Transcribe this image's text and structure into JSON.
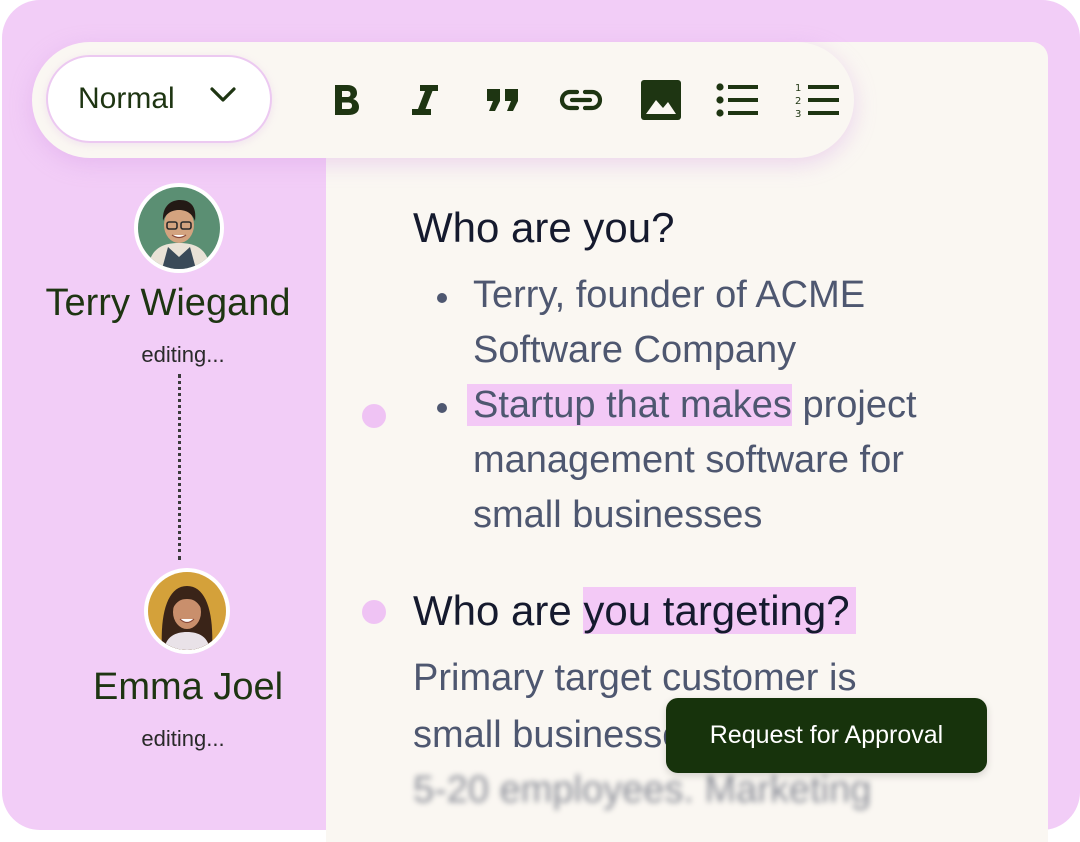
{
  "toolbar": {
    "style_select": {
      "value": "Normal",
      "icon": "chevron-down-icon"
    },
    "buttons": [
      {
        "name": "bold",
        "icon": "bold-icon"
      },
      {
        "name": "italic",
        "icon": "italic-icon"
      },
      {
        "name": "quote",
        "icon": "quote-icon"
      },
      {
        "name": "link",
        "icon": "link-icon"
      },
      {
        "name": "image",
        "icon": "image-icon"
      },
      {
        "name": "bulleted-list",
        "icon": "bulleted-list-icon"
      },
      {
        "name": "numbered-list",
        "icon": "numbered-list-icon"
      }
    ]
  },
  "collaborators": [
    {
      "name": "Terry Wiegand",
      "status": "editing..."
    },
    {
      "name": "Emma Joel",
      "status": "editing..."
    }
  ],
  "document": {
    "section1": {
      "heading": "Who are you?",
      "bullets": [
        {
          "lines": [
            "Terry, founder of ACME",
            "Software Company"
          ]
        },
        {
          "highlight": "Startup that makes",
          "rest": " project",
          "lines": [
            "management software for",
            "small businesses"
          ]
        }
      ]
    },
    "section2": {
      "heading_plain": "Who are ",
      "heading_highlight": "you targeting? ",
      "lines": [
        "Primary target customer is",
        "small businesses",
        "5-20 employees. Marketing"
      ]
    }
  },
  "actions": {
    "request_approval": "Request for Approval"
  },
  "colors": {
    "frame": "#f2cdf7",
    "document": "#faf7f2",
    "highlight": "#f3c9f6",
    "primary_button": "#17330c",
    "icon": "#1e3512"
  }
}
